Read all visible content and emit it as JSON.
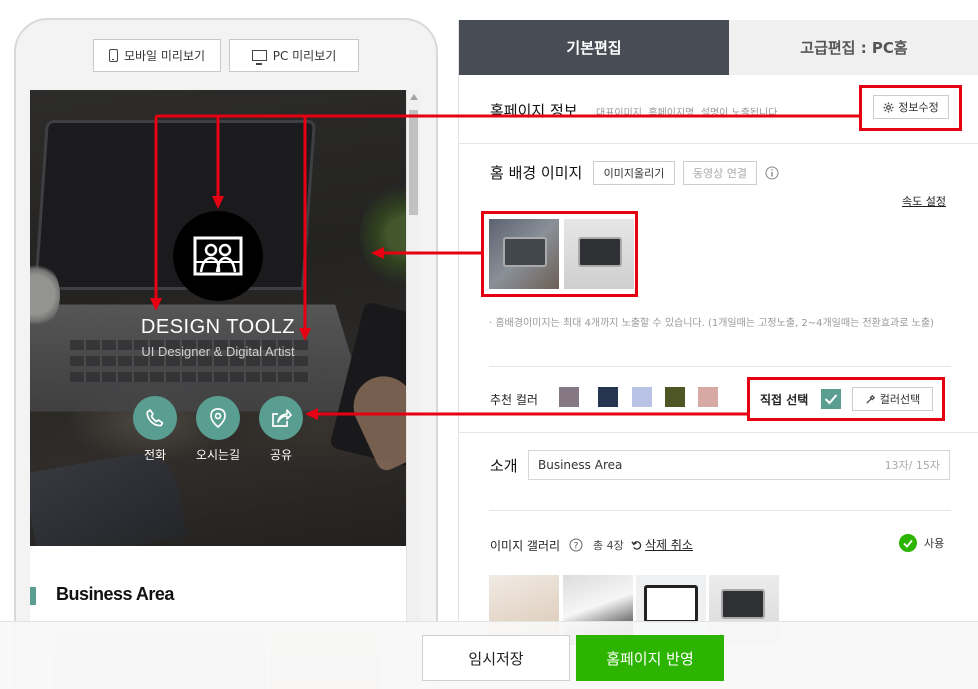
{
  "preview": {
    "mobile_label": "모바일 미리보기",
    "pc_label": "PC 미리보기"
  },
  "mobile_screen": {
    "title": "DESIGN TOOLZ",
    "subtitle": "UI Designer & Digital Artist",
    "actions": [
      {
        "label": "전화",
        "icon": "phone-icon"
      },
      {
        "label": "오시는길",
        "icon": "map-pin-icon"
      },
      {
        "label": "공유",
        "icon": "share-icon"
      }
    ],
    "section_title": "Business Area"
  },
  "tabs": {
    "basic": "기본편집",
    "advanced": "고급편집 : PC홈"
  },
  "homepage_info": {
    "title": "홈페이지 정보",
    "hint": "대표이미지, 홈페이지명, 설명이 노출됩니다.",
    "edit_button": "정보수정"
  },
  "bg_image": {
    "title": "홈 배경 이미지",
    "upload_button": "이미지올리기",
    "video_button": "동영상 연결",
    "speed_link": "속도 설정",
    "note": "홈배경이미지는 최대 4개까지 노출할 수 있습니다. (1개일때는 고정노출, 2~4개일때는 전환효과로 노출)"
  },
  "colors": {
    "recommend_label": "추천 컬러",
    "swatches": [
      "#857783",
      "#263650",
      "#b9c3e6",
      "#4e5626",
      "#d6a9a4"
    ],
    "direct_label": "직접 선택",
    "picker_button": "컬러선택",
    "selected_color": "#5a9e92"
  },
  "intro": {
    "label": "소개",
    "value": "Business Area",
    "count": "13자/ 15자"
  },
  "gallery": {
    "label": "이미지 갤러리",
    "count": "총 4장",
    "undo_delete": "삭제 취소",
    "use_label": "사용"
  },
  "footer": {
    "save_button": "임시저장",
    "publish_button": "홈페이지 반영"
  },
  "accent": {
    "annotation": "#e60012",
    "primary_green": "#2db400",
    "teal": "#5a9e92",
    "tab_dark": "#484c55"
  }
}
